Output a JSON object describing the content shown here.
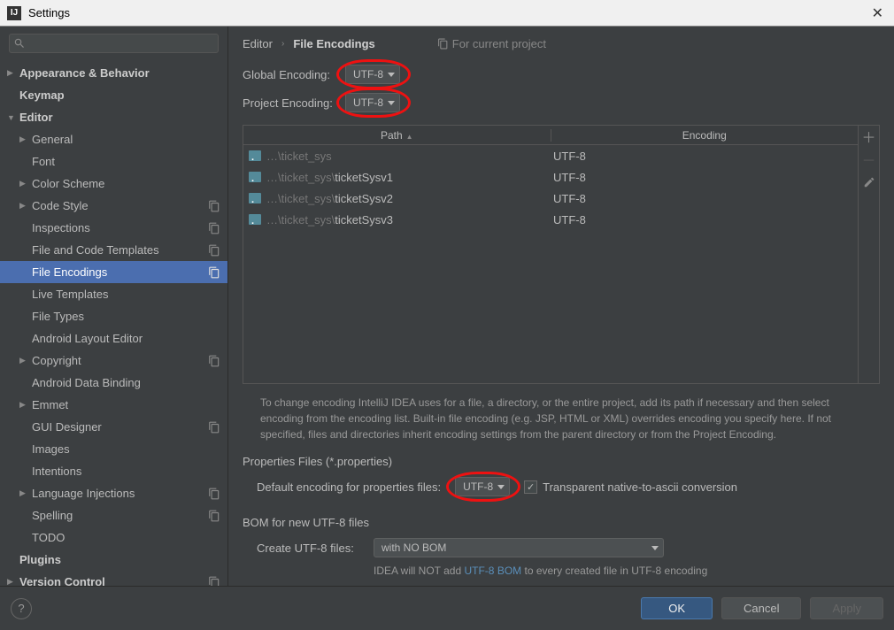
{
  "window": {
    "title": "Settings"
  },
  "search": {
    "placeholder": ""
  },
  "sidebar": {
    "items": [
      {
        "label": "Appearance & Behavior",
        "arrow": "▶",
        "bold": true,
        "indent": 0,
        "icon": false
      },
      {
        "label": "Keymap",
        "arrow": "",
        "bold": true,
        "indent": 0,
        "icon": false
      },
      {
        "label": "Editor",
        "arrow": "▼",
        "bold": true,
        "indent": 0,
        "icon": false
      },
      {
        "label": "General",
        "arrow": "▶",
        "bold": false,
        "indent": 1,
        "icon": false
      },
      {
        "label": "Font",
        "arrow": "",
        "bold": false,
        "indent": 1,
        "icon": false
      },
      {
        "label": "Color Scheme",
        "arrow": "▶",
        "bold": false,
        "indent": 1,
        "icon": false
      },
      {
        "label": "Code Style",
        "arrow": "▶",
        "bold": false,
        "indent": 1,
        "icon": true
      },
      {
        "label": "Inspections",
        "arrow": "",
        "bold": false,
        "indent": 1,
        "icon": true
      },
      {
        "label": "File and Code Templates",
        "arrow": "",
        "bold": false,
        "indent": 1,
        "icon": true
      },
      {
        "label": "File Encodings",
        "arrow": "",
        "bold": false,
        "indent": 1,
        "icon": true,
        "selected": true
      },
      {
        "label": "Live Templates",
        "arrow": "",
        "bold": false,
        "indent": 1,
        "icon": false
      },
      {
        "label": "File Types",
        "arrow": "",
        "bold": false,
        "indent": 1,
        "icon": false
      },
      {
        "label": "Android Layout Editor",
        "arrow": "",
        "bold": false,
        "indent": 1,
        "icon": false
      },
      {
        "label": "Copyright",
        "arrow": "▶",
        "bold": false,
        "indent": 1,
        "icon": true
      },
      {
        "label": "Android Data Binding",
        "arrow": "",
        "bold": false,
        "indent": 1,
        "icon": false
      },
      {
        "label": "Emmet",
        "arrow": "▶",
        "bold": false,
        "indent": 1,
        "icon": false
      },
      {
        "label": "GUI Designer",
        "arrow": "",
        "bold": false,
        "indent": 1,
        "icon": true
      },
      {
        "label": "Images",
        "arrow": "",
        "bold": false,
        "indent": 1,
        "icon": false
      },
      {
        "label": "Intentions",
        "arrow": "",
        "bold": false,
        "indent": 1,
        "icon": false
      },
      {
        "label": "Language Injections",
        "arrow": "▶",
        "bold": false,
        "indent": 1,
        "icon": true
      },
      {
        "label": "Spelling",
        "arrow": "",
        "bold": false,
        "indent": 1,
        "icon": true
      },
      {
        "label": "TODO",
        "arrow": "",
        "bold": false,
        "indent": 1,
        "icon": false
      },
      {
        "label": "Plugins",
        "arrow": "",
        "bold": true,
        "indent": 0,
        "icon": false
      },
      {
        "label": "Version Control",
        "arrow": "▶",
        "bold": true,
        "indent": 0,
        "icon": true
      }
    ]
  },
  "breadcrumb": {
    "parent": "Editor",
    "current": "File Encodings",
    "project_hint": "For current project"
  },
  "settings": {
    "global_encoding_label": "Global Encoding:",
    "global_encoding_value": "UTF-8",
    "project_encoding_label": "Project Encoding:",
    "project_encoding_value": "UTF-8"
  },
  "table": {
    "head_path": "Path",
    "head_enc": "Encoding",
    "rows": [
      {
        "dim": "…\\ticket_sys",
        "name": "",
        "enc": "UTF-8"
      },
      {
        "dim": "…\\ticket_sys\\",
        "name": "ticketSysv1",
        "enc": "UTF-8"
      },
      {
        "dim": "…\\ticket_sys\\",
        "name": "ticketSysv2",
        "enc": "UTF-8"
      },
      {
        "dim": "…\\ticket_sys\\",
        "name": "ticketSysv3",
        "enc": "UTF-8"
      }
    ]
  },
  "help_text": "To change encoding IntelliJ IDEA uses for a file, a directory, or the entire project, add its path if necessary and then select encoding from the encoding list. Built-in file encoding (e.g. JSP, HTML or XML) overrides encoding you specify here. If not specified, files and directories inherit encoding settings from the parent directory or from the Project Encoding.",
  "properties": {
    "title": "Properties Files (*.properties)",
    "default_label": "Default encoding for properties files:",
    "default_value": "UTF-8",
    "transparent_label": "Transparent native-to-ascii conversion"
  },
  "bom": {
    "title": "BOM for new UTF-8 files",
    "create_label": "Create UTF-8 files:",
    "create_value": "with NO BOM",
    "note_prefix": "IDEA will NOT add ",
    "note_link": "UTF-8 BOM",
    "note_suffix": " to every created file in UTF-8 encoding"
  },
  "footer": {
    "ok": "OK",
    "cancel": "Cancel",
    "apply": "Apply",
    "help": "?"
  }
}
